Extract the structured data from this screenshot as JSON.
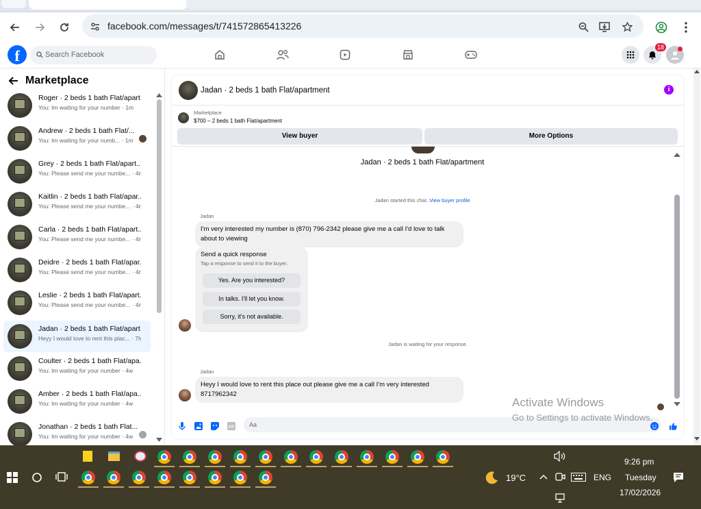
{
  "browser": {
    "url": "facebook.com/messages/t/741572865413226"
  },
  "fb": {
    "search_placeholder": "Search Facebook",
    "notification_count": "18"
  },
  "sidebar": {
    "title": "Marketplace",
    "conversations": [
      {
        "name": "Roger · 2 beds 1 bath Flat/apart...",
        "preview": "You: Im waiting for your number · 1m"
      },
      {
        "name": "Andrew · 2 beds 1 bath Flat/...",
        "preview": "You: Im waiting for your numb... · 1m"
      },
      {
        "name": "Grey · 2 beds 1 bath Flat/apart...",
        "preview": "You: Please send me your numbe... · 4m"
      },
      {
        "name": "Kaitlin · 2 beds 1 bath Flat/apar...",
        "preview": "You: Please send me your numbe... · 4m"
      },
      {
        "name": "Carla · 2 beds 1 bath Flat/apart...",
        "preview": "You: Please send me your numbe... · 4m"
      },
      {
        "name": "Deidre · 2 beds 1 bath Flat/apar...",
        "preview": "You: Please send me your numbe... · 4m"
      },
      {
        "name": "Leslie · 2 beds 1 bath Flat/apart...",
        "preview": "You: Please send me your numbe... · 4m"
      },
      {
        "name": "Jadan · 2 beds 1 bath Flat/apart...",
        "preview": "Heyy I would love to rent this plac... · 7h"
      },
      {
        "name": "Coulter · 2 beds 1 bath Flat/apa...",
        "preview": "You: Im waiting for your number · 4w"
      },
      {
        "name": "Amber · 2 beds 1 bath Flat/apa...",
        "preview": "You: Im waiting for your number · 4w"
      },
      {
        "name": "Jonathan · 2 beds 1 bath Flat...",
        "preview": "You: Im waiting for your number · 4w"
      }
    ]
  },
  "chat": {
    "title": "Jadan · 2 beds 1 bath Flat/apartment",
    "listing_tag": "Marketplace",
    "listing_price": "$700 – 2 beds 1 bath Flat/apartment",
    "view_buyer": "View buyer",
    "more_options": "More Options",
    "center_title": "Jadan · 2 beds 1 bath Flat/apartment",
    "started_text": "Jadan started this chat.",
    "view_profile_link": "View buyer profile",
    "sender1": "Jadan",
    "message1": "I'm very interested my number is (870) 796-2342 please give me a call I'd love to talk about to viewing",
    "quick_title": "Send a quick response",
    "quick_sub": "Tap a response to send it to the buyer.",
    "quick_replies": [
      "Yes. Are you interested?",
      "In talks. I'll let you know.",
      "Sorry, it's not available."
    ],
    "waiting_text": "Jadan is waiting for your response.",
    "sender2": "Jadan",
    "message2": "Heyy I would love to rent this place out please give me a call I'm very interested 8717962342",
    "composer_placeholder": "Aa"
  },
  "watermark": {
    "line1": "Activate Windows",
    "line2": "Go to Settings to activate Windows."
  },
  "taskbar": {
    "temperature": "19°C",
    "language": "ENG",
    "time": "9:26 pm",
    "day": "Tuesday",
    "date": "17/02/2026"
  }
}
